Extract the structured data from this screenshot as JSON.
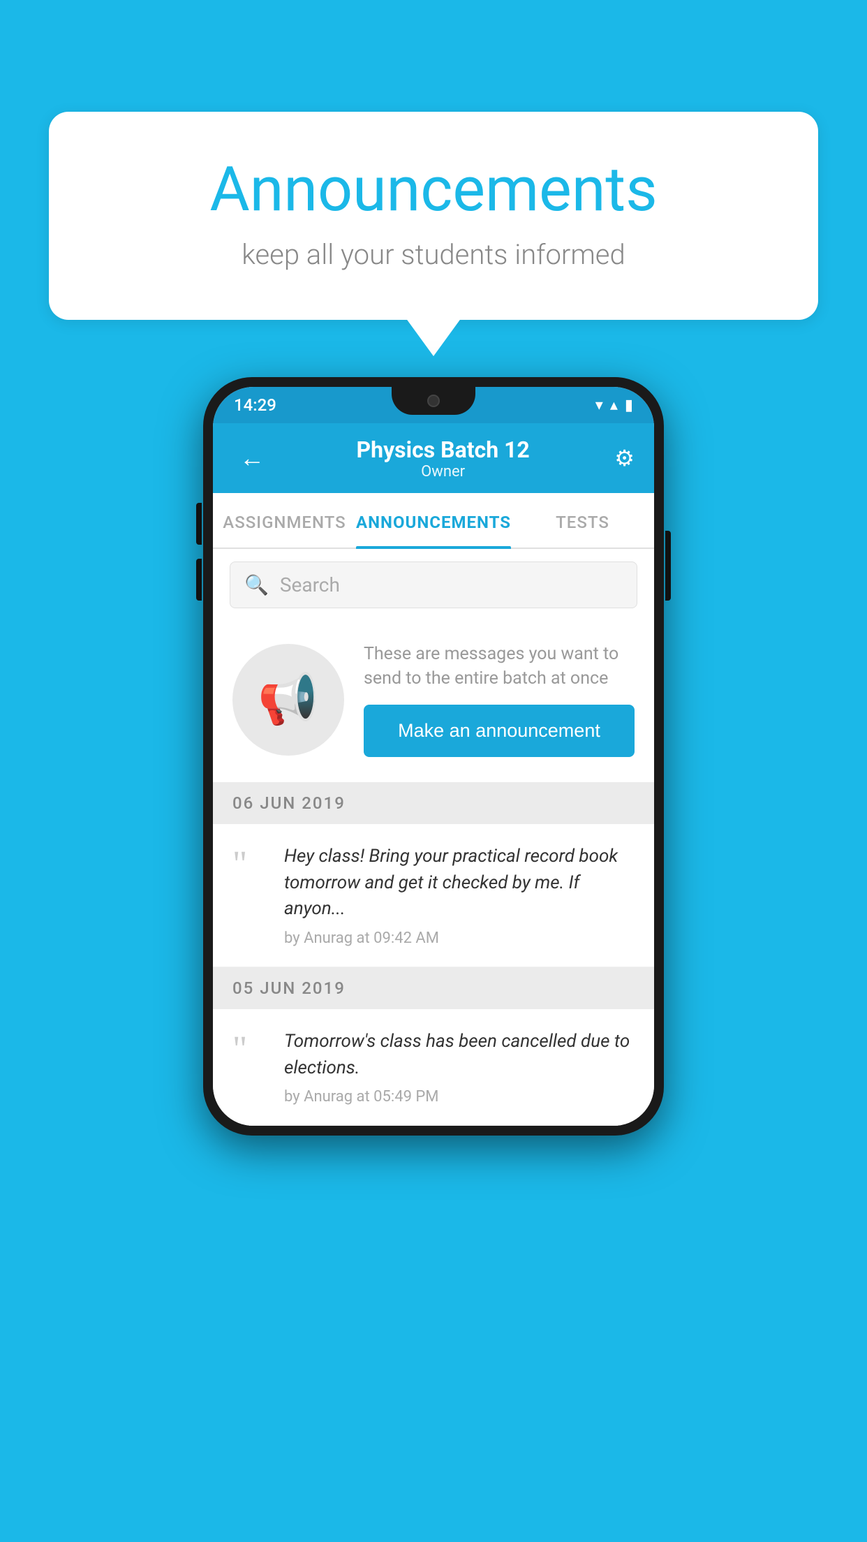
{
  "background_color": "#1bb8e8",
  "speech_bubble": {
    "title": "Announcements",
    "subtitle": "keep all your students informed"
  },
  "phone": {
    "status_bar": {
      "time": "14:29",
      "icons": [
        "▾▴",
        "◂▸",
        "▮"
      ]
    },
    "app_bar": {
      "back_icon": "←",
      "title": "Physics Batch 12",
      "subtitle": "Owner",
      "settings_icon": "⚙"
    },
    "tabs": [
      {
        "label": "ASSIGNMENTS",
        "active": false
      },
      {
        "label": "ANNOUNCEMENTS",
        "active": true
      },
      {
        "label": "TESTS",
        "active": false
      }
    ],
    "search": {
      "placeholder": "Search",
      "icon": "🔍"
    },
    "promo": {
      "description": "These are messages you want to send to the entire batch at once",
      "button_label": "Make an announcement"
    },
    "announcements": [
      {
        "date": "06  JUN  2019",
        "text": "Hey class! Bring your practical record book tomorrow and get it checked by me. If anyon...",
        "meta": "by Anurag at 09:42 AM"
      },
      {
        "date": "05  JUN  2019",
        "text": "Tomorrow's class has been cancelled due to elections.",
        "meta": "by Anurag at 05:49 PM"
      }
    ]
  }
}
